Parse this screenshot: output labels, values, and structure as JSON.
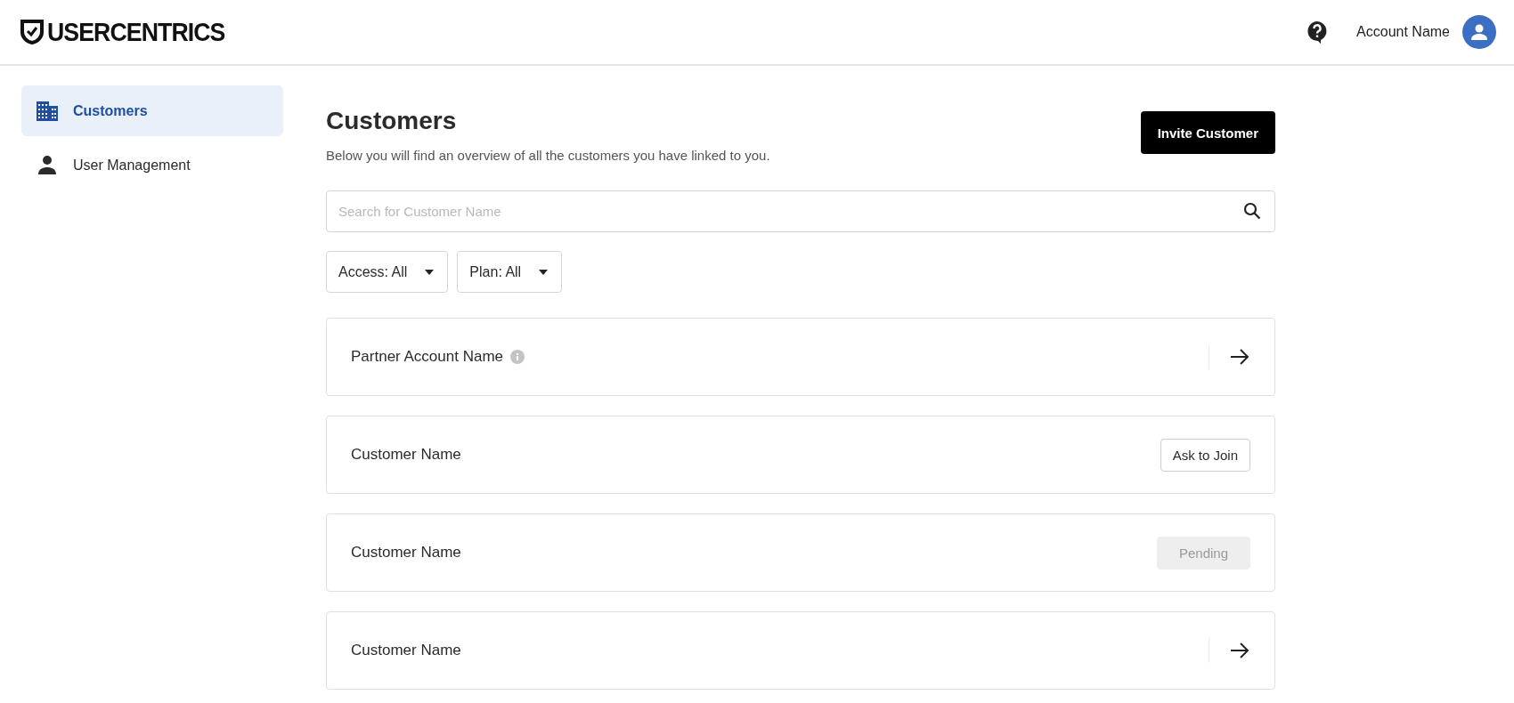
{
  "header": {
    "logo": "USERCENTRICS",
    "account_name": "Account Name"
  },
  "sidebar": {
    "items": [
      {
        "label": "Customers",
        "kind": "building",
        "selected": true
      },
      {
        "label": "User Management",
        "kind": "person",
        "selected": false
      }
    ]
  },
  "page": {
    "title": "Customers",
    "subtitle": "Below you will find an overview of all the customers you have linked to you.",
    "invite_button": "Invite Customer"
  },
  "search": {
    "placeholder": "Search for Customer Name"
  },
  "filters": [
    {
      "label": "Access: All"
    },
    {
      "label": "Plan: All"
    }
  ],
  "customers": [
    {
      "name": "Partner Account Name",
      "info": true,
      "kind": "link"
    },
    {
      "name": "Customer Name",
      "info": false,
      "kind": "action",
      "action": "Ask to Join",
      "disabled": false
    },
    {
      "name": "Customer Name",
      "info": false,
      "kind": "action",
      "action": "Pending",
      "disabled": true
    },
    {
      "name": "Customer Name",
      "info": false,
      "kind": "link"
    }
  ]
}
